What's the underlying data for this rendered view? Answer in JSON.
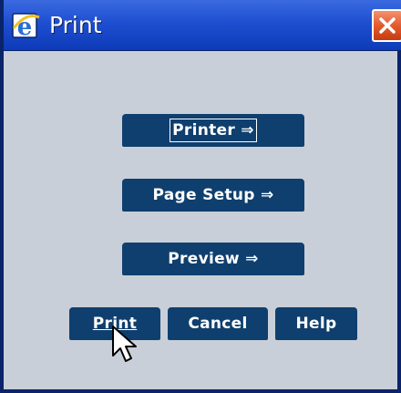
{
  "window": {
    "title": "Print",
    "app_icon": "internet-explorer-icon",
    "close_icon": "close-icon"
  },
  "buttons": {
    "printer": "Printer ⇒",
    "page_setup": "Page Setup ⇒",
    "preview": "Preview ⇒",
    "print": "Print",
    "cancel": "Cancel",
    "help": "Help"
  },
  "colors": {
    "titlebar": "#1e4fd0",
    "dialog_bg": "#c9cfd8",
    "button_bg": "#0f3f6e",
    "close_button": "#e45a2e"
  },
  "cursor": "arrow-pointer-icon"
}
